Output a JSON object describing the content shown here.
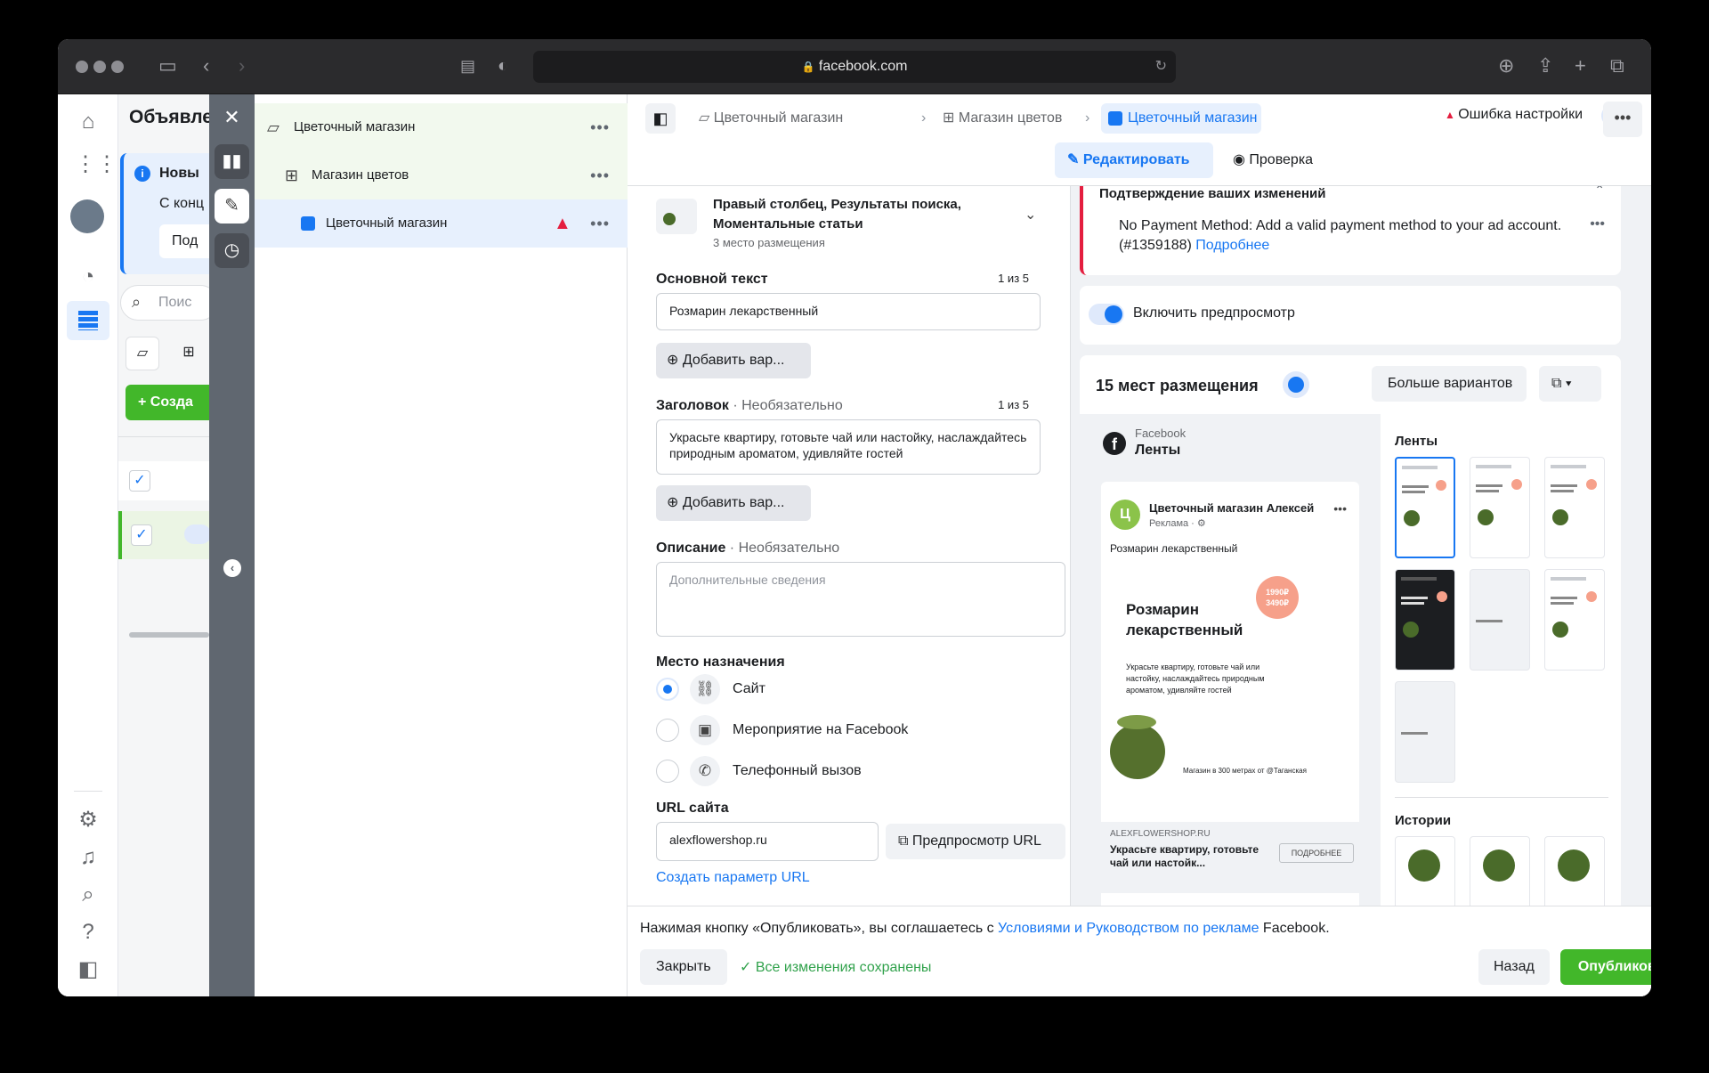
{
  "browser": {
    "url": "facebook.com"
  },
  "colA": {
    "title": "Объявле",
    "info_title": "Новы",
    "info_text": "С конц",
    "info_btn": "Под",
    "search_placeholder": "Поис",
    "create_label": "Созда"
  },
  "tree": {
    "items": [
      {
        "label": "Цветочный магазин"
      },
      {
        "label": "Магазин цветов"
      },
      {
        "label": "Цветочный магазин"
      }
    ]
  },
  "editor": {
    "breadcrumbs": [
      "Цветочный магазин",
      "Магазин цветов",
      "Цветочный магазин"
    ],
    "status": "Ошибка настройки",
    "tab_edit": "Редактировать",
    "tab_review": "Проверка"
  },
  "form": {
    "placement_title": "Правый столбец, Результаты поиска, Моментальные статьи",
    "placement_sub": "3 место размещения",
    "primary_text_label": "Основной текст",
    "primary_text_count": "1 из 5",
    "primary_text_value": "Розмарин лекарственный",
    "add_variant": "Добавить вар...",
    "headline_label": "Заголовок",
    "optional": "· Необязательно",
    "headline_count": "1 из 5",
    "headline_value": "Украсьте квартиру, готовьте чай или настойку, наслаждайтесь природным ароматом, удивляйте гостей",
    "description_label": "Описание",
    "description_placeholder": "Дополнительные сведения",
    "destination_label": "Место назначения",
    "destinations": [
      "Сайт",
      "Мероприятие на Facebook",
      "Телефонный вызов"
    ],
    "url_label": "URL сайта",
    "url_value": "alexflowershop.ru",
    "url_preview_btn": "Предпросмотр URL",
    "create_param": "Создать параметр URL"
  },
  "preview": {
    "error_title": "Подтверждение ваших изменений",
    "error_text": "No Payment Method: Add a valid payment method to your ad account. (#1359188)",
    "error_link": "Подробнее",
    "toggle_label": "Включить предпросмотр",
    "placements_title": "15 мест размещения",
    "more_variants": "Больше вариантов",
    "platform": "Facebook",
    "platform_sub": "Ленты",
    "page_name": "Цветочный магазин Алексей",
    "page_initial": "Ц",
    "sponsored": "Реклама · ⚙",
    "ad_primary": "Розмарин лекарственный",
    "creative_title": "Розмарин лекарственный",
    "creative_price": "1990₽ 3490₽",
    "creative_body": "Украсьте квартиру, готовьте чай или настойку, наслаждайтесь природным ароматом, удивляйте гостей",
    "creative_footer": "Магазин в 300 метрах от @Таганская",
    "link_domain": "ALEXFLOWERSHOP.RU",
    "link_headline": "Украсьте квартиру, готовьте чай или настойк...",
    "cta": "ПОДРОБНЕЕ",
    "feeds_label": "Ленты",
    "stories_label": "Истории"
  },
  "footer": {
    "terms_prefix": "Нажимая кнопку «Опубликовать», вы соглашаетесь с ",
    "terms_link": "Условиями и Руководством по рекламе",
    "terms_suffix": " Facebook.",
    "close": "Закрыть",
    "saved": "Все изменения сохранены",
    "back": "Назад",
    "publish": "Опубликовать"
  },
  "colors": {
    "accent": "#1877f2",
    "publish": "#42b72a",
    "error": "#e41e3f"
  }
}
